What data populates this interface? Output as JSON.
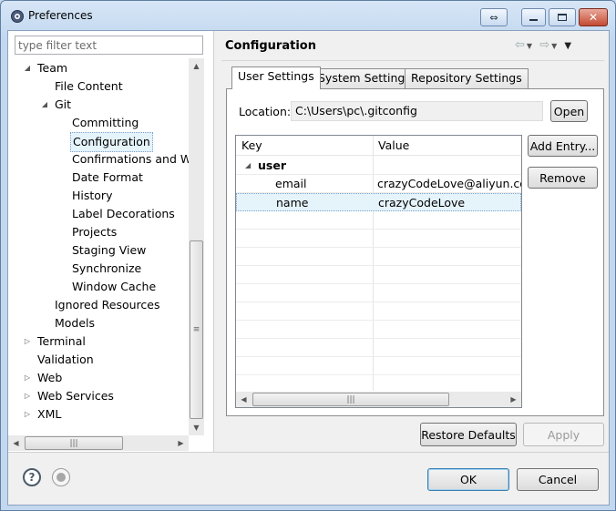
{
  "window": {
    "title": "Preferences"
  },
  "filter": {
    "placeholder": "type filter text"
  },
  "tree": {
    "items": [
      {
        "label": "Team",
        "indent": 1,
        "twisty": "expanded"
      },
      {
        "label": "File Content",
        "indent": 2,
        "twisty": "none"
      },
      {
        "label": "Git",
        "indent": 2,
        "twisty": "expanded"
      },
      {
        "label": "Committing",
        "indent": 3,
        "twisty": "none"
      },
      {
        "label": "Configuration",
        "indent": 3,
        "twisty": "none",
        "selected": true
      },
      {
        "label": "Confirmations and Wa",
        "indent": 3,
        "twisty": "none"
      },
      {
        "label": "Date Format",
        "indent": 3,
        "twisty": "none"
      },
      {
        "label": "History",
        "indent": 3,
        "twisty": "none"
      },
      {
        "label": "Label Decorations",
        "indent": 3,
        "twisty": "none"
      },
      {
        "label": "Projects",
        "indent": 3,
        "twisty": "none"
      },
      {
        "label": "Staging View",
        "indent": 3,
        "twisty": "none"
      },
      {
        "label": "Synchronize",
        "indent": 3,
        "twisty": "none"
      },
      {
        "label": "Window Cache",
        "indent": 3,
        "twisty": "none"
      },
      {
        "label": "Ignored Resources",
        "indent": 2,
        "twisty": "none"
      },
      {
        "label": "Models",
        "indent": 2,
        "twisty": "none"
      },
      {
        "label": "Terminal",
        "indent": 1,
        "twisty": "collapsed"
      },
      {
        "label": "Validation",
        "indent": 1,
        "twisty": "none"
      },
      {
        "label": "Web",
        "indent": 1,
        "twisty": "collapsed"
      },
      {
        "label": "Web Services",
        "indent": 1,
        "twisty": "collapsed"
      },
      {
        "label": "XML",
        "indent": 1,
        "twisty": "collapsed"
      }
    ]
  },
  "page": {
    "title": "Configuration"
  },
  "tabs": [
    {
      "label": "User Settings",
      "active": true
    },
    {
      "label": "System Settings",
      "active": false
    },
    {
      "label": "Repository Settings",
      "active": false
    }
  ],
  "location": {
    "label": "Location:",
    "value": "C:\\Users\\pc\\.gitconfig",
    "open_label": "Open"
  },
  "grid": {
    "columns": [
      "Key",
      "Value"
    ],
    "rows": [
      {
        "key": "user",
        "value": "",
        "group": true
      },
      {
        "key": "email",
        "value": "crazyCodeLove@aliyun.com",
        "group": false
      },
      {
        "key": "name",
        "value": "crazyCodeLove",
        "group": false,
        "selected": true
      }
    ]
  },
  "actions": {
    "add_entry": "Add Entry...",
    "remove": "Remove"
  },
  "footer": {
    "restore_defaults": "Restore Defaults",
    "apply": "Apply",
    "ok": "OK",
    "cancel": "Cancel"
  },
  "icons": {
    "app": "eclipse-gear-icon",
    "help": "help-icon",
    "record": "record-icon"
  }
}
